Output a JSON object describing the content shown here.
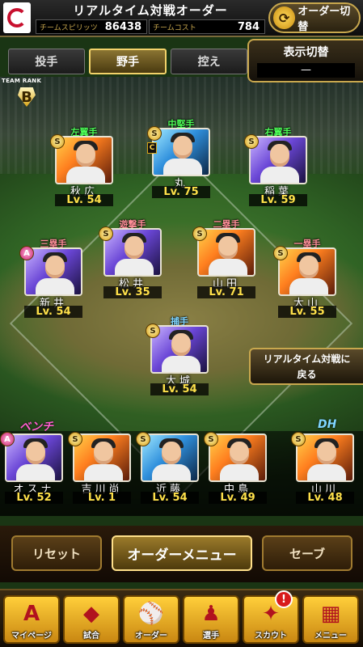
{
  "header": {
    "title": "リアルタイム対戦オーダー",
    "spirits_label": "チームスピリッツ",
    "spirits_value": "86438",
    "cost_label": "チームコスト",
    "cost_value": "784",
    "order_switch_label": "オーダー切替"
  },
  "tabs": [
    {
      "label": "投手"
    },
    {
      "label": "野手"
    },
    {
      "label": "控え"
    }
  ],
  "display_toggle": {
    "title": "表示切替",
    "value": "—"
  },
  "team_rank": {
    "label": "TEAM RANK",
    "value": "B"
  },
  "players": {
    "lf": {
      "position": "左翼手",
      "name": "秋広",
      "level": "Lv. 54",
      "badge": "S"
    },
    "cf": {
      "position": "中堅手",
      "name": "丸",
      "level": "Lv. 75",
      "badge": "S",
      "captain": "C"
    },
    "rf": {
      "position": "右翼手",
      "name": "稲葉",
      "level": "Lv. 59",
      "badge": "S"
    },
    "ss": {
      "position": "遊撃手",
      "name": "松井",
      "level": "Lv. 35",
      "badge": "S"
    },
    "b2": {
      "position": "二塁手",
      "name": "山田",
      "level": "Lv. 71",
      "badge": "S"
    },
    "b3": {
      "position": "三塁手",
      "name": "新井",
      "level": "Lv. 54",
      "badge": "A"
    },
    "b1": {
      "position": "一塁手",
      "name": "大山",
      "level": "Lv. 55",
      "badge": "S"
    },
    "c": {
      "position": "捕手",
      "name": "大城",
      "level": "Lv. 54",
      "badge": "S"
    }
  },
  "realtime_back": {
    "line1": "リアルタイム対戦に",
    "line2": "戻る"
  },
  "bench_label": "ベンチ",
  "dh_label": "DH",
  "bench": [
    {
      "name": "オスナ",
      "level": "Lv. 52",
      "badge": "A"
    },
    {
      "name": "吉川尚",
      "level": "Lv.  1",
      "badge": "S"
    },
    {
      "name": "近藤",
      "level": "Lv. 54",
      "badge": "S"
    },
    {
      "name": "中島",
      "level": "Lv. 49",
      "badge": "S"
    },
    {
      "name": "山川",
      "level": "Lv. 48",
      "badge": "S"
    }
  ],
  "actions": {
    "reset": "リセット",
    "menu": "オーダーメニュー",
    "save": "セーブ"
  },
  "nav": [
    {
      "label": "マイページ",
      "icon": "A"
    },
    {
      "label": "試合",
      "icon": "◆"
    },
    {
      "label": "オーダー",
      "icon": "⚾"
    },
    {
      "label": "選手",
      "icon": "♟"
    },
    {
      "label": "スカウト",
      "icon": "✦"
    },
    {
      "label": "メニュー",
      "icon": "▦"
    }
  ],
  "nav_notification": "!"
}
